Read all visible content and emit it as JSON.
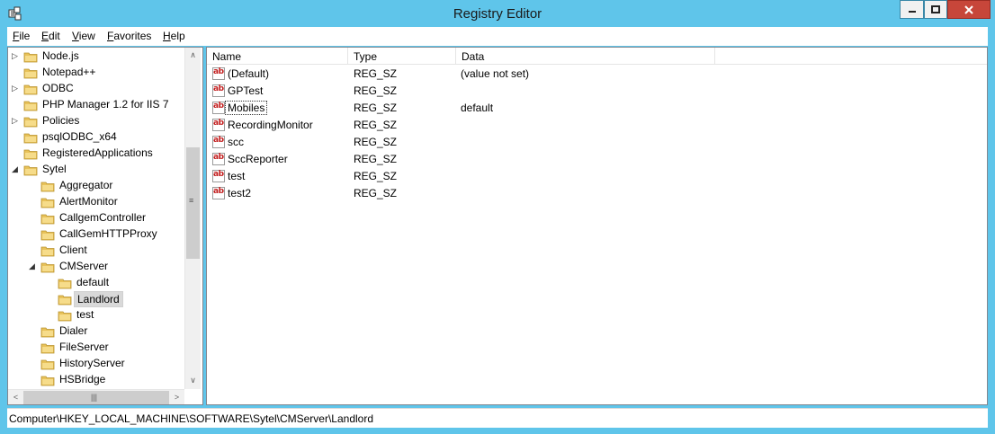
{
  "window": {
    "title": "Registry Editor"
  },
  "menu": [
    {
      "key": "F",
      "rest": "ile"
    },
    {
      "key": "E",
      "rest": "dit"
    },
    {
      "key": "V",
      "rest": "iew"
    },
    {
      "key": "F",
      "rest": "a",
      "pre": "",
      "full": "Favorites"
    },
    {
      "key": "H",
      "rest": "elp"
    }
  ],
  "menu_labels": [
    "File",
    "Edit",
    "View",
    "Favorites",
    "Help"
  ],
  "tree": [
    {
      "label": "Node.js",
      "level": 0,
      "expander": "collapsed"
    },
    {
      "label": "Notepad++",
      "level": 0,
      "expander": "none"
    },
    {
      "label": "ODBC",
      "level": 0,
      "expander": "collapsed"
    },
    {
      "label": "PHP Manager 1.2 for IIS 7",
      "level": 0,
      "expander": "none"
    },
    {
      "label": "Policies",
      "level": 0,
      "expander": "collapsed"
    },
    {
      "label": "psqlODBC_x64",
      "level": 0,
      "expander": "none"
    },
    {
      "label": "RegisteredApplications",
      "level": 0,
      "expander": "none"
    },
    {
      "label": "Sytel",
      "level": 0,
      "expander": "expanded"
    },
    {
      "label": "Aggregator",
      "level": 1,
      "expander": "none"
    },
    {
      "label": "AlertMonitor",
      "level": 1,
      "expander": "none"
    },
    {
      "label": "CallgemController",
      "level": 1,
      "expander": "none"
    },
    {
      "label": "CallGemHTTPProxy",
      "level": 1,
      "expander": "none"
    },
    {
      "label": "Client",
      "level": 1,
      "expander": "none"
    },
    {
      "label": "CMServer",
      "level": 1,
      "expander": "expanded"
    },
    {
      "label": "default",
      "level": 2,
      "expander": "none"
    },
    {
      "label": "Landlord",
      "level": 2,
      "expander": "none",
      "selected": true
    },
    {
      "label": "test",
      "level": 2,
      "expander": "none"
    },
    {
      "label": "Dialer",
      "level": 1,
      "expander": "none"
    },
    {
      "label": "FileServer",
      "level": 1,
      "expander": "none"
    },
    {
      "label": "HistoryServer",
      "level": 1,
      "expander": "none"
    },
    {
      "label": "HSBridge",
      "level": 1,
      "expander": "none"
    }
  ],
  "columns": [
    "Name",
    "Type",
    "Data"
  ],
  "values": [
    {
      "name": "(Default)",
      "type": "REG_SZ",
      "data": "(value not set)"
    },
    {
      "name": "GPTest",
      "type": "REG_SZ",
      "data": ""
    },
    {
      "name": "Mobiles",
      "type": "REG_SZ",
      "data": "default",
      "focused": true
    },
    {
      "name": "RecordingMonitor",
      "type": "REG_SZ",
      "data": ""
    },
    {
      "name": "scc",
      "type": "REG_SZ",
      "data": ""
    },
    {
      "name": "SccReporter",
      "type": "REG_SZ",
      "data": ""
    },
    {
      "name": "test",
      "type": "REG_SZ",
      "data": ""
    },
    {
      "name": "test2",
      "type": "REG_SZ",
      "data": ""
    }
  ],
  "value_icon": {
    "name": "string-value-icon",
    "glyph": "ab"
  },
  "status": {
    "path": "Computer\\HKEY_LOCAL_MACHINE\\SOFTWARE\\Sytel\\CMServer\\Landlord"
  },
  "scroll_glyphs": {
    "up": "∧",
    "down": "∨",
    "left": "<",
    "right": ">",
    "vgrip": "≡",
    "hgrip": "|||"
  },
  "colors": {
    "frame": "#5fc5ea",
    "close": "#c7463a",
    "folder": "#e8c25a",
    "selection": "#d9d9d9",
    "icon_text": "#c21d1d"
  }
}
